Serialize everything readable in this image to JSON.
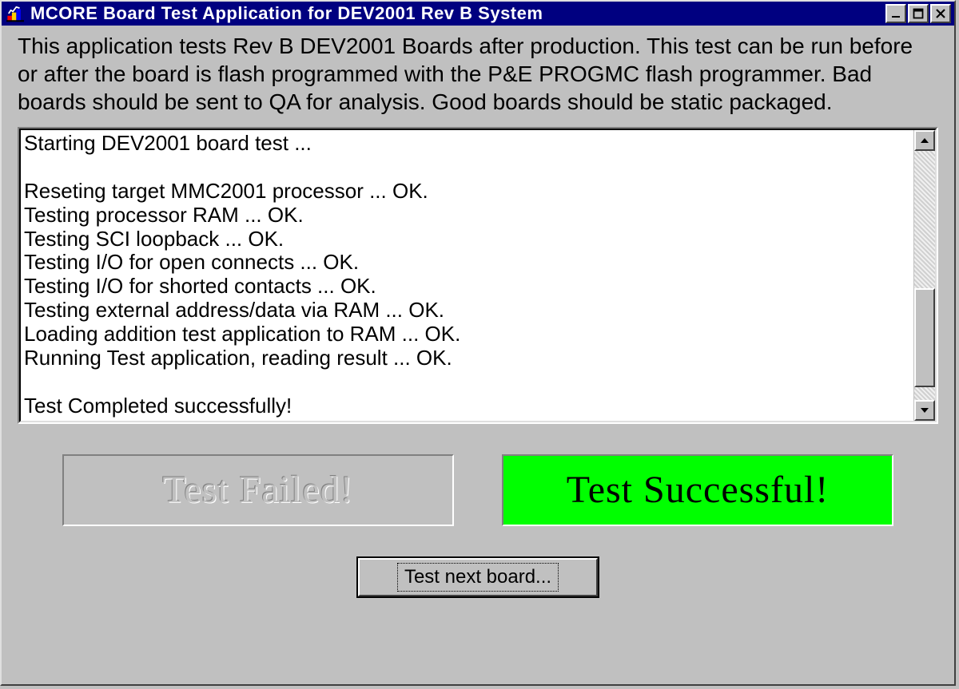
{
  "window": {
    "title": "MCORE Board Test Application for DEV2001 Rev B System"
  },
  "description": "This application tests Rev B DEV2001 Boards after production.  This test can be run before or after the board is flash programmed with the P&E PROGMC flash programmer. Bad boards should be sent to QA for analysis. Good boards should be static packaged.",
  "log": {
    "lines": [
      "Starting DEV2001 board test ...",
      "",
      "Reseting target MMC2001 processor ... OK.",
      "Testing processor RAM ... OK.",
      "Testing SCI loopback ... OK.",
      "Testing I/O for open connects ... OK.",
      "Testing I/O for shorted contacts ... OK.",
      "Testing external address/data via RAM ... OK.",
      "Loading addition test application to RAM ... OK.",
      "Running Test application, reading result ... OK.",
      "",
      "Test Completed successfully!"
    ],
    "joined": "Starting DEV2001 board test ...\n\nReseting target MMC2001 processor ... OK.\nTesting processor RAM ... OK.\nTesting SCI loopback ... OK.\nTesting I/O for open connects ... OK.\nTesting I/O for shorted contacts ... OK.\nTesting external address/data via RAM ... OK.\nLoading addition test application to RAM ... OK.\nRunning Test application, reading result ... OK.\n\nTest Completed successfully!"
  },
  "status": {
    "failed_label": "Test Failed!",
    "success_label": "Test Successful!",
    "failed_active": false,
    "success_active": true,
    "success_color": "#00ff00"
  },
  "buttons": {
    "test_next": "Test next board..."
  },
  "scrollbar": {
    "thumb_top_pct": 55,
    "thumb_height_pct": 40
  }
}
